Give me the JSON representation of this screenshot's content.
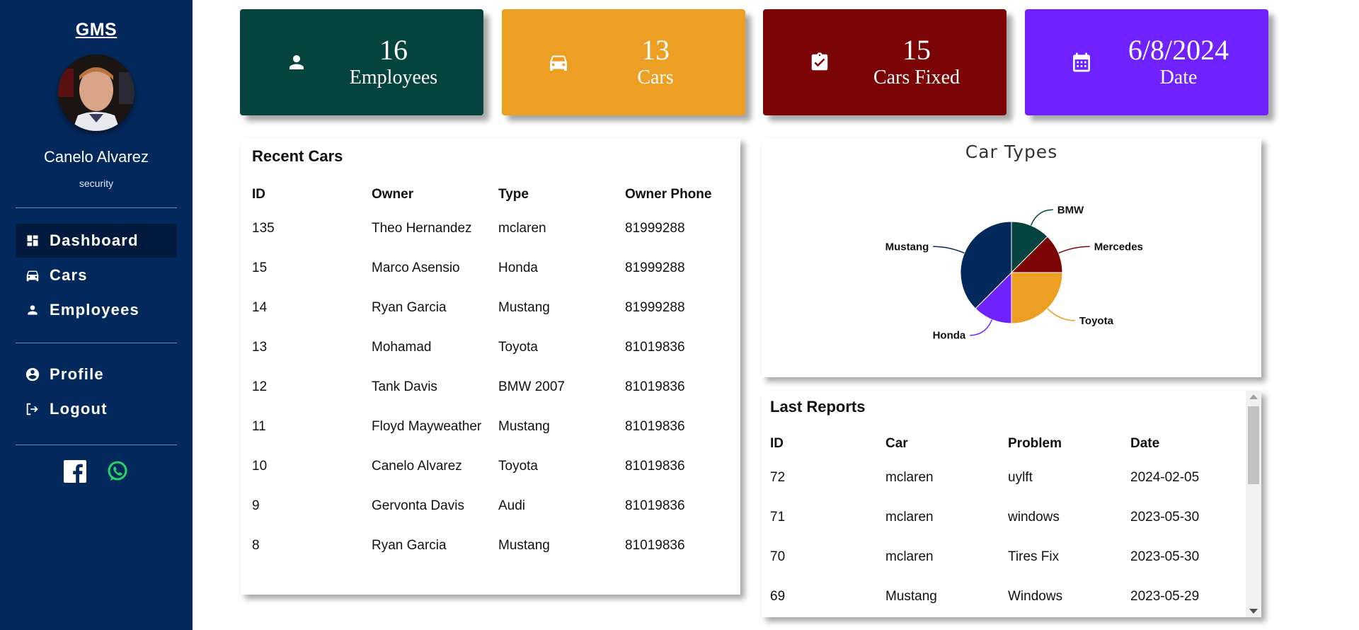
{
  "sidebar": {
    "brand": "GMS",
    "user_name": "Canelo Alvarez",
    "user_role": "security",
    "nav": [
      {
        "label": "Dashboard",
        "icon": "dashboard-icon"
      },
      {
        "label": "Cars",
        "icon": "car-icon"
      },
      {
        "label": "Employees",
        "icon": "person-icon"
      }
    ],
    "account": [
      {
        "label": "Profile",
        "icon": "account-circle-icon"
      },
      {
        "label": "Logout",
        "icon": "logout-icon"
      }
    ],
    "social": [
      "facebook-icon",
      "whatsapp-icon"
    ]
  },
  "stats": [
    {
      "value": "16",
      "label": "Employees",
      "icon": "person-icon",
      "color": "#05433e"
    },
    {
      "value": "13",
      "label": "Cars",
      "icon": "car-icon",
      "color": "#ec9f22"
    },
    {
      "value": "15",
      "label": "Cars Fixed",
      "icon": "clipboard-check-icon",
      "color": "#7b0506"
    },
    {
      "value": "6/8/2024",
      "label": "Date",
      "icon": "calendar-icon",
      "color": "#6f22ff"
    }
  ],
  "recent_cars": {
    "title": "Recent Cars",
    "headers": [
      "ID",
      "Owner",
      "Type",
      "Owner Phone"
    ],
    "rows": [
      [
        "135",
        "Theo Hernandez",
        "mclaren",
        "81999288"
      ],
      [
        "15",
        "Marco Asensio",
        "Honda",
        "81999288"
      ],
      [
        "14",
        "Ryan Garcia",
        "Mustang",
        "81999288"
      ],
      [
        "13",
        "Mohamad",
        "Toyota",
        "81019836"
      ],
      [
        "12",
        "Tank Davis",
        "BMW 2007",
        "81019836"
      ],
      [
        "11",
        "Floyd Mayweather",
        "Mustang",
        "81019836"
      ],
      [
        "10",
        "Canelo Alvarez",
        "Toyota",
        "81019836"
      ],
      [
        "9",
        "Gervonta Davis",
        "Audi",
        "81019836"
      ],
      [
        "8",
        "Ryan Garcia",
        "Mustang",
        "81019836"
      ]
    ]
  },
  "last_reports": {
    "title": "Last Reports",
    "headers": [
      "ID",
      "Car",
      "Problem",
      "Date"
    ],
    "rows": [
      [
        "72",
        "mclaren",
        "uylft",
        "2024-02-05"
      ],
      [
        "71",
        "mclaren",
        "windows",
        "2023-05-30"
      ],
      [
        "70",
        "mclaren",
        "Tires Fix",
        "2023-05-30"
      ],
      [
        "69",
        "Mustang",
        "Windows",
        "2023-05-29"
      ]
    ]
  },
  "chart_data": {
    "type": "pie",
    "title": "Car Types",
    "labels": [
      "BMW",
      "Mercedes",
      "Toyota",
      "Honda",
      "Mustang"
    ],
    "values": [
      1,
      1,
      2,
      1,
      3
    ],
    "colors": [
      "#05433e",
      "#7b0506",
      "#ec9f22",
      "#6f22ff",
      "#03295c"
    ]
  }
}
